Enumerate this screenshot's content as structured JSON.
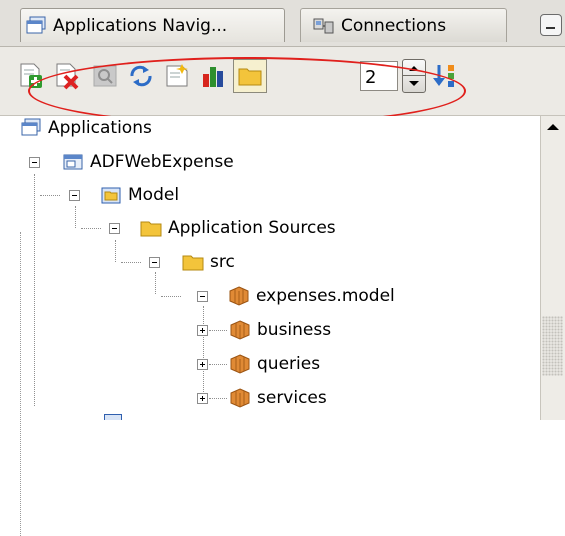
{
  "tabs": [
    {
      "label": "Applications Navig...",
      "icon": "applications-icon",
      "active": true
    },
    {
      "label": "Connections",
      "icon": "connections-icon",
      "active": false
    }
  ],
  "toolbar": {
    "buttons": [
      {
        "name": "new-icon",
        "enabled": true
      },
      {
        "name": "delete-icon",
        "enabled": true
      },
      {
        "name": "search-icon",
        "enabled": false
      },
      {
        "name": "refresh-icon",
        "enabled": true
      },
      {
        "name": "edit-icon",
        "enabled": true
      },
      {
        "name": "chart-icon",
        "enabled": true
      },
      {
        "name": "folder-icon",
        "enabled": true,
        "pressed": true
      },
      {
        "name": "sort-icon",
        "enabled": true
      }
    ],
    "level_value": "2"
  },
  "tree": {
    "root_label": "Applications",
    "nodes": [
      {
        "label": "ADFWebExpense",
        "icon": "workspace-icon",
        "expanded": true
      },
      {
        "label": "Model",
        "icon": "project-icon",
        "expanded": true
      },
      {
        "label": "Application Sources",
        "icon": "folder-icon",
        "expanded": true
      },
      {
        "label": "src",
        "icon": "folder-icon",
        "expanded": true
      },
      {
        "label": "expenses.model",
        "icon": "package-icon",
        "expanded": true
      },
      {
        "label": "business",
        "icon": "package-icon",
        "expanded": false
      },
      {
        "label": "queries",
        "icon": "package-icon",
        "expanded": false
      },
      {
        "label": "services",
        "icon": "package-icon",
        "expanded": false
      }
    ]
  },
  "colors": {
    "highlight_oval": "#e0201c",
    "folder": "#f3c43b",
    "package": "#d77d2e"
  }
}
